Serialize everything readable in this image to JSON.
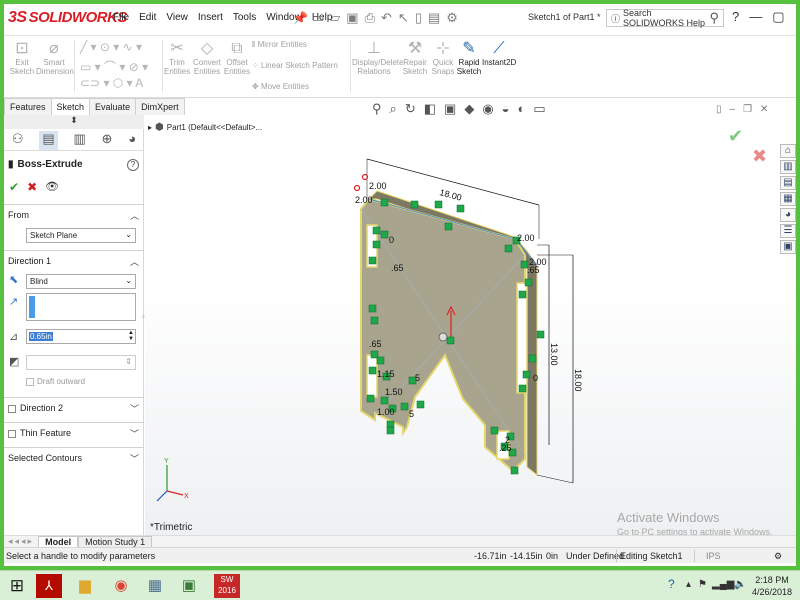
{
  "app": {
    "logo_ds": "3S",
    "logo_text": "SOLIDWORKS",
    "menu": [
      "File",
      "Edit",
      "View",
      "Insert",
      "Tools",
      "Window",
      "Help"
    ],
    "document_title": "Sketch1 of Part1 *",
    "search_placeholder": "Search SOLIDWORKS Help"
  },
  "commands": {
    "exit_sketch": "Exit Sketch",
    "smart_dimension": "Smart Dimension",
    "trim_entities": "Trim Entities",
    "convert_entities": "Convert Entities",
    "offset_entities": "Offset Entities",
    "mirror_entities": "Mirror Entities",
    "linear_sketch_pattern": "Linear Sketch Pattern",
    "move_entities": "Move Entities",
    "display_delete_relations": "Display/Delete Relations",
    "repair_sketch": "Repair Sketch",
    "quick_snaps": "Quick Snaps",
    "rapid_sketch": "Rapid Sketch",
    "instant2d": "Instant2D"
  },
  "tabs": [
    "Features",
    "Sketch",
    "Evaluate",
    "DimXpert"
  ],
  "active_tab": "Sketch",
  "panel": {
    "feature_title": "Boss-Extrude",
    "from_label": "From",
    "from_value": "Sketch Plane",
    "direction1_label": "Direction 1",
    "end_condition": "Blind",
    "depth_value": "0.65in",
    "draft_outward": "Draft outward",
    "direction2_label": "Direction 2",
    "thin_feature_label": "Thin Feature",
    "selected_contours_label": "Selected Contours"
  },
  "tree": {
    "part_label": "Part1  (Default<<Default>..."
  },
  "viewport": {
    "view_name": "*Trimetric",
    "dims": {
      "top_width": "18.00",
      "left_small_a": "2.00",
      "left_small_b": "2.00",
      "right_small_a": "2.00",
      "right_small_b": "2.00",
      "height_inner": "13.00",
      "height_outer": "18.00",
      "slot_a": ".65",
      "slot_b": ".65",
      "num_0": "0",
      "num_1": "1.50",
      "num_2": "5",
      "num_3": ".25",
      "num_4": "5",
      "num_5": "1.15",
      "num_6": "0",
      "num_7": ".65",
      "num_8": "2",
      "num_9": "1.00"
    },
    "activate_heading": "Activate Windows",
    "activate_sub": "Go to PC settings to activate Windows."
  },
  "bottom_tabs": [
    "Model",
    "Motion Study 1"
  ],
  "status": {
    "message": "Select a handle to modify parameters",
    "x": "-16.71in",
    "y": "-14.15in",
    "z": "0in",
    "sketch_state": "Under Defined",
    "editing": "Editing Sketch1",
    "units": "IPS"
  },
  "taskbar": {
    "time": "2:18 PM",
    "date": "4/26/2018",
    "sw_label": "SW 2016"
  },
  "colors": {
    "frame": "#56c13f",
    "brand": "#d81f26",
    "part_fill": "#a8a48e",
    "part_edge": "#e3d66a",
    "taskbar": "#d9f0d6"
  }
}
